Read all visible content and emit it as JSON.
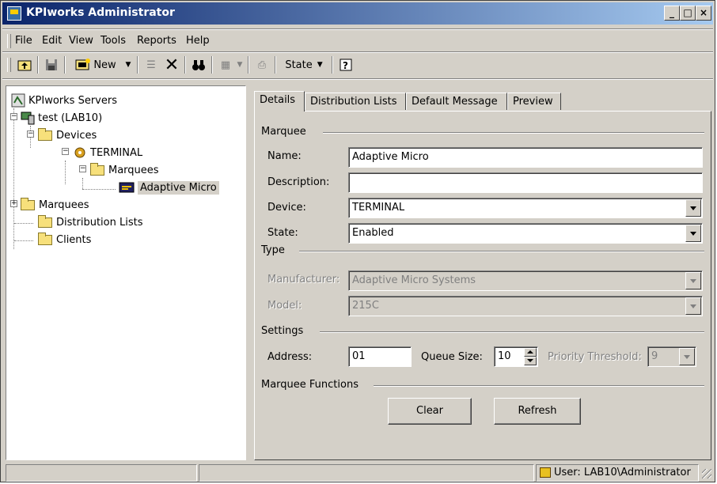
{
  "window": {
    "title": "KPIworks Administrator",
    "minimize": "_",
    "maximize": "□",
    "close": "×"
  },
  "menu": {
    "items": [
      "File",
      "Edit",
      "View",
      "Tools",
      "Reports",
      "Help"
    ]
  },
  "toolbar": {
    "new_label": "New",
    "state_label": "State"
  },
  "tree": {
    "root": "KPIworks Servers",
    "server": "test (LAB10)",
    "devices": "Devices",
    "terminal": "TERMINAL",
    "marquees_sub": "Marquees",
    "adaptive": "Adaptive Micro",
    "marquees": "Marquees",
    "distribution": "Distribution Lists",
    "clients": "Clients"
  },
  "tabs": [
    "Details",
    "Distribution Lists",
    "Default Message",
    "Preview"
  ],
  "form": {
    "group_marquee": "Marquee",
    "name_label": "Name:",
    "name_value": "Adaptive Micro",
    "description_label": "Description:",
    "description_value": "",
    "device_label": "Device:",
    "device_value": "TERMINAL",
    "state_label": "State:",
    "state_value": "Enabled",
    "group_type": "Type",
    "manufacturer_label": "Manufacturer:",
    "manufacturer_value": "Adaptive Micro Systems",
    "model_label": "Model:",
    "model_value": "215C",
    "group_settings": "Settings",
    "address_label": "Address:",
    "address_value": "01",
    "queue_label": "Queue Size:",
    "queue_value": "10",
    "priority_label": "Priority Threshold:",
    "priority_value": "9",
    "group_functions": "Marquee Functions",
    "clear_label": "Clear",
    "refresh_label": "Refresh"
  },
  "status": {
    "user": "User: LAB10\\Administrator"
  }
}
